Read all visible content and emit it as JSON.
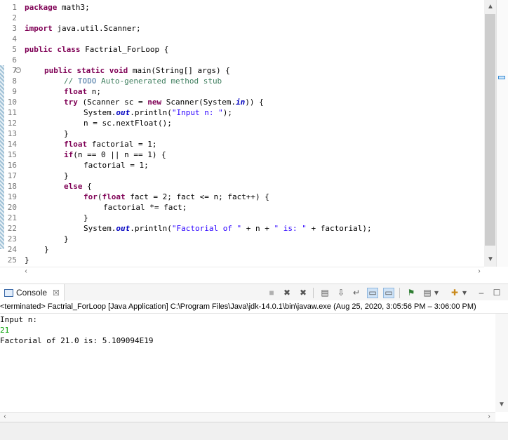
{
  "editor": {
    "line_numbers": [
      "1",
      "2",
      "3",
      "4",
      "5",
      "6",
      "7",
      "8",
      "9",
      "10",
      "11",
      "12",
      "13",
      "14",
      "15",
      "16",
      "17",
      "18",
      "19",
      "20",
      "21",
      "22",
      "23",
      "24",
      "25"
    ],
    "fold_marker": "−"
  },
  "code": {
    "package_kw": "package",
    "package_name": " math3;",
    "import_kw": "import",
    "import_name": " java.util.Scanner;",
    "class_kw": "public class",
    "class_name": " Factrial_ForLoop {",
    "method_kw": "public static void",
    "method_sig": " main(String[] args) {",
    "comment_prefix": "// ",
    "comment_todo": "TODO",
    "comment_text": " Auto-generated method stub",
    "float_kw": "float",
    "float_decl": " n;",
    "try_kw": "try",
    "try_open": " (Scanner sc = ",
    "new_kw": "new",
    "scanner_ctor": " Scanner(System.",
    "in_field": "in",
    "try_close": ")) {",
    "print1_a": "System.",
    "out_field": "out",
    "print1_b": ".println(",
    "print1_str": "\"Input n: \"",
    "print1_c": ");",
    "read_line": "n = sc.nextFloat();",
    "close_brace": "}",
    "fact_decl_kw": "float",
    "fact_decl": " factorial = 1;",
    "if_kw": "if",
    "if_cond": "(n == 0 || n == 1) {",
    "fact_assign": "factorial = 1;",
    "else_kw": "else",
    "else_rest": " {",
    "for_kw": "for",
    "for_paren": "(",
    "for_float_kw": "float",
    "for_rest": " fact = 2; fact <= n; fact++) {",
    "fact_mult": "factorial *= fact;",
    "print2_a": "System.",
    "print2_b": ".println(",
    "print2_str1": "\"Factorial of \"",
    "print2_mid": " + n + ",
    "print2_str2": "\" is: \"",
    "print2_end": " + factorial);"
  },
  "console": {
    "tab_label": "Console",
    "tab_close": "☒",
    "status": "<terminated> Factrial_ForLoop [Java Application] C:\\Program Files\\Java\\jdk-14.0.1\\bin\\javaw.exe  (Aug 25, 2020, 3:05:56 PM – 3:06:00 PM)",
    "output_lines": [
      "Input n:",
      "21",
      "Factorial of 21.0 is: 5.109094E19"
    ]
  },
  "toolbar": {
    "terminate_icon": "■",
    "remove_launch_icon": "✖",
    "remove_all_icon": "✖",
    "clear_icon": "▤",
    "scroll_lock_icon": "⇩",
    "word_wrap_icon": "↵",
    "show_stdout_icon": "▭",
    "show_stderr_icon": "▭",
    "pin_icon": "⚑",
    "display_console_icon": "▤",
    "dropdown_icon": "▾",
    "new_console_icon": "✚",
    "minimize_icon": "‒",
    "maximize_icon": "☐"
  },
  "scroll": {
    "up": "▲",
    "down": "▼",
    "left": "‹",
    "right": "›"
  },
  "colors": {
    "keyword": "#7f0055",
    "string": "#2a00ff",
    "comment": "#3f7f5f",
    "field": "#0000c0",
    "stdin": "#00a000"
  }
}
